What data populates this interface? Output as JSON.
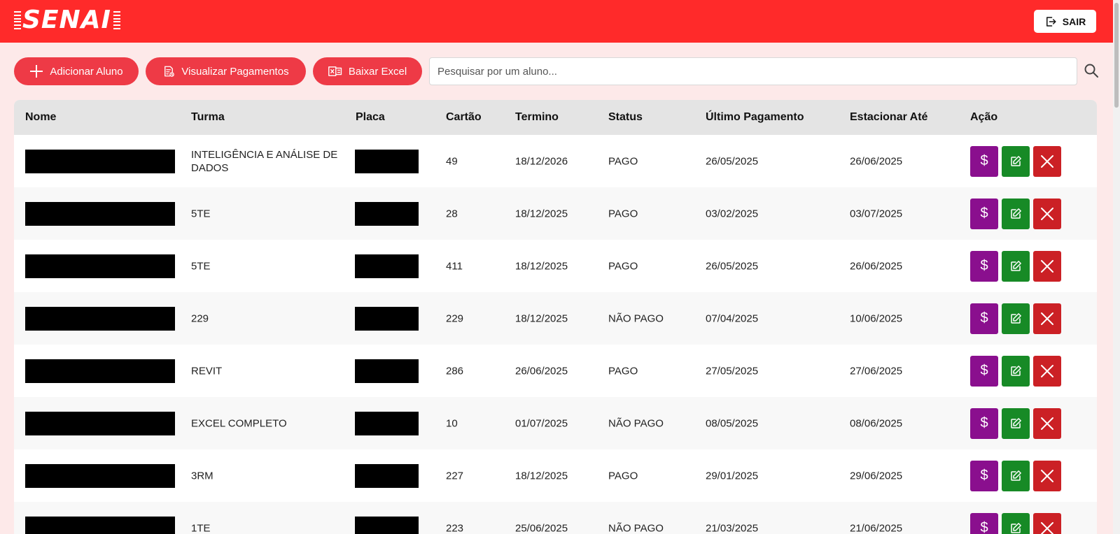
{
  "header": {
    "logo_text": "SENAI",
    "logout_label": "SAIR",
    "background_color": "#ff2a2a"
  },
  "toolbar": {
    "add_student_label": "Adicionar Aluno",
    "view_payments_label": "Visualizar Pagamentos",
    "download_excel_label": "Baixar Excel",
    "search_placeholder": "Pesquisar por um aluno...",
    "search_value": "",
    "button_color": "#ee3a46"
  },
  "table": {
    "columns": [
      "Nome",
      "Turma",
      "Placa",
      "Cartão",
      "Termino",
      "Status",
      "Último Pagamento",
      "Estacionar Até",
      "Ação"
    ],
    "rows": [
      {
        "turma": "INTELIGÊNCIA E ANÁLISE DE DADOS",
        "cartao": "49",
        "termino": "18/12/2026",
        "status": "PAGO",
        "ultimo_pagamento": "26/05/2025",
        "estacionar_ate": "26/06/2025"
      },
      {
        "turma": "5TE",
        "cartao": "28",
        "termino": "18/12/2025",
        "status": "PAGO",
        "ultimo_pagamento": "03/02/2025",
        "estacionar_ate": "03/07/2025"
      },
      {
        "turma": "5TE",
        "cartao": "411",
        "termino": "18/12/2025",
        "status": "PAGO",
        "ultimo_pagamento": "26/05/2025",
        "estacionar_ate": "26/06/2025"
      },
      {
        "turma": "229",
        "cartao": "229",
        "termino": "18/12/2025",
        "status": "NÃO PAGO",
        "ultimo_pagamento": "07/04/2025",
        "estacionar_ate": "10/06/2025"
      },
      {
        "turma": "REVIT",
        "cartao": "286",
        "termino": "26/06/2025",
        "status": "PAGO",
        "ultimo_pagamento": "27/05/2025",
        "estacionar_ate": "27/06/2025"
      },
      {
        "turma": "EXCEL COMPLETO",
        "cartao": "10",
        "termino": "01/07/2025",
        "status": "NÃO PAGO",
        "ultimo_pagamento": "08/05/2025",
        "estacionar_ate": "08/06/2025"
      },
      {
        "turma": "3RM",
        "cartao": "227",
        "termino": "18/12/2025",
        "status": "PAGO",
        "ultimo_pagamento": "29/01/2025",
        "estacionar_ate": "29/06/2025"
      },
      {
        "turma": "1TE",
        "cartao": "223",
        "termino": "25/06/2025",
        "status": "NÃO PAGO",
        "ultimo_pagamento": "21/03/2025",
        "estacionar_ate": "21/06/2025"
      }
    ],
    "actions": {
      "pay_symbol": "$",
      "pay_icon": "dollar-icon",
      "edit_icon": "edit-icon",
      "delete_icon": "close-icon",
      "pay_color": "#8a0f8e",
      "edit_color": "#178a26",
      "delete_color": "#cb2025"
    }
  }
}
